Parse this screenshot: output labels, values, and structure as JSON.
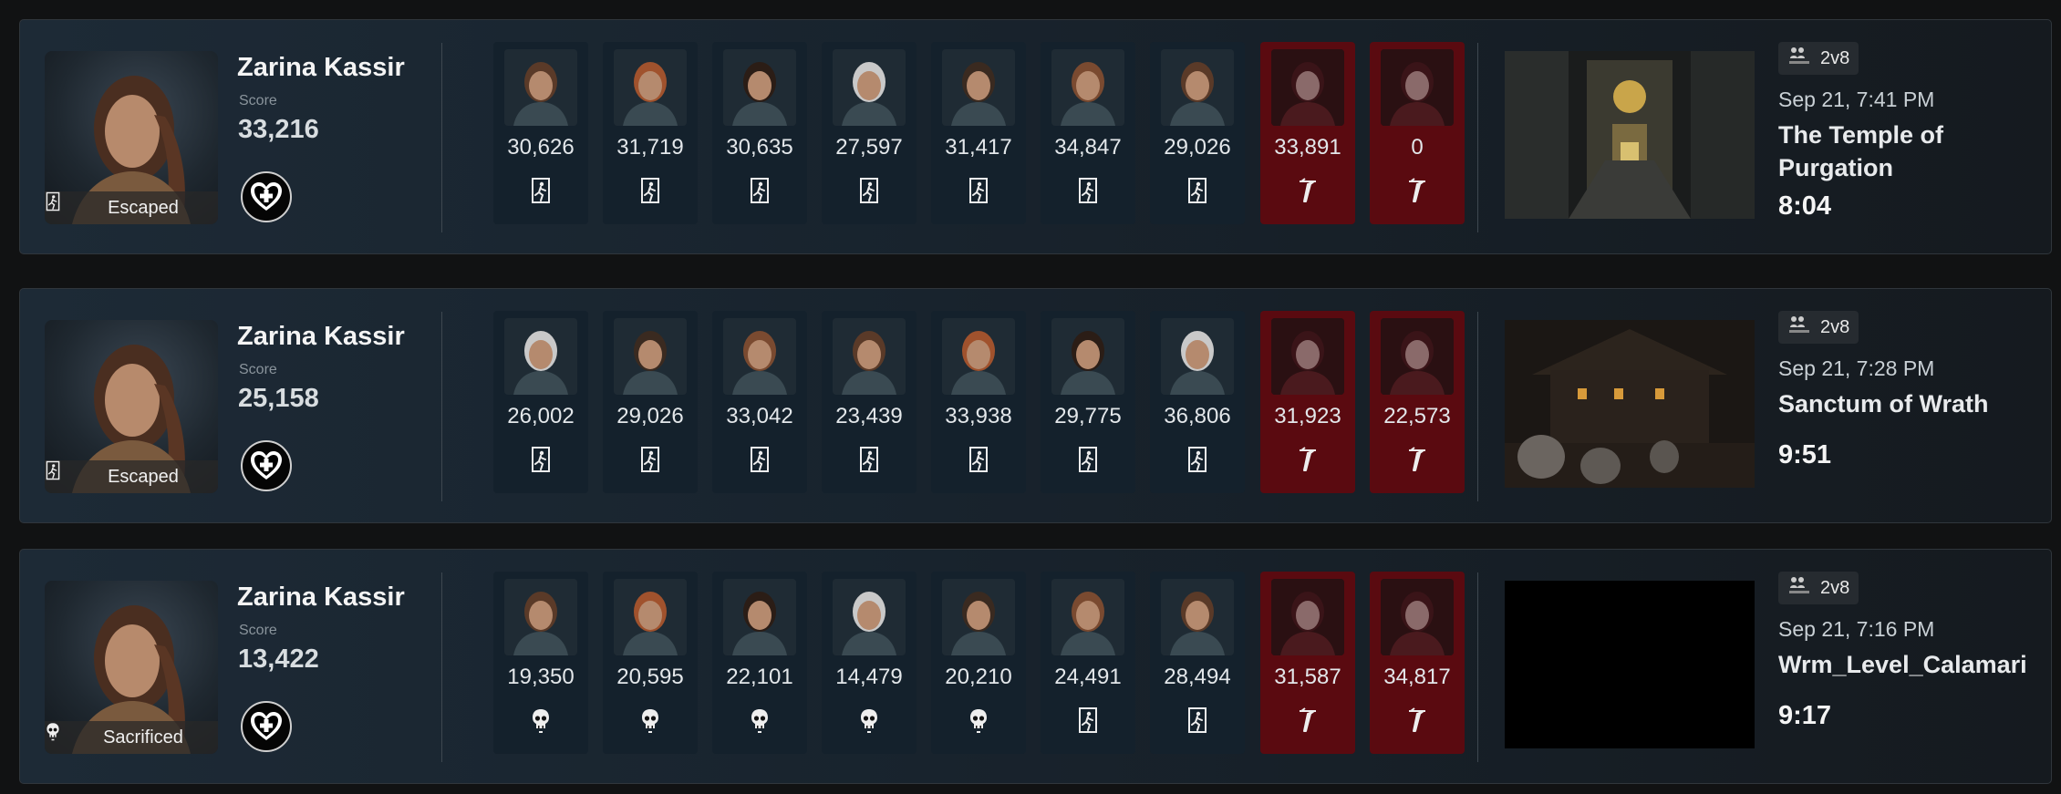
{
  "score_label": "Score",
  "matches": [
    {
      "player_name": "Zarina Kassir",
      "score": "33,216",
      "result": "Escaped",
      "result_icon": "escape-door-icon",
      "mode": "2v8",
      "date": "Sep 21, 7:41 PM",
      "map_name": "The Temple of Purgation",
      "duration": "8:04",
      "map_image": "temple",
      "participants": [
        {
          "score": "30,626",
          "role": "survivor",
          "result": "escaped"
        },
        {
          "score": "31,719",
          "role": "survivor",
          "result": "escaped"
        },
        {
          "score": "30,635",
          "role": "survivor",
          "result": "escaped"
        },
        {
          "score": "27,597",
          "role": "survivor",
          "result": "escaped"
        },
        {
          "score": "31,417",
          "role": "survivor",
          "result": "escaped"
        },
        {
          "score": "34,847",
          "role": "survivor",
          "result": "escaped"
        },
        {
          "score": "29,026",
          "role": "survivor",
          "result": "escaped"
        },
        {
          "score": "33,891",
          "role": "killer",
          "result": "killer"
        },
        {
          "score": "0",
          "role": "killer",
          "result": "killer"
        }
      ]
    },
    {
      "player_name": "Zarina Kassir",
      "score": "25,158",
      "result": "Escaped",
      "result_icon": "escape-door-icon",
      "mode": "2v8",
      "date": "Sep 21, 7:28 PM",
      "map_name": "Sanctum of Wrath",
      "duration": "9:51",
      "map_image": "sanctum",
      "participants": [
        {
          "score": "26,002",
          "role": "survivor",
          "result": "escaped"
        },
        {
          "score": "29,026",
          "role": "survivor",
          "result": "escaped"
        },
        {
          "score": "33,042",
          "role": "survivor",
          "result": "escaped"
        },
        {
          "score": "23,439",
          "role": "survivor",
          "result": "escaped"
        },
        {
          "score": "33,938",
          "role": "survivor",
          "result": "escaped"
        },
        {
          "score": "29,775",
          "role": "survivor",
          "result": "escaped"
        },
        {
          "score": "36,806",
          "role": "survivor",
          "result": "escaped"
        },
        {
          "score": "31,923",
          "role": "killer",
          "result": "killer"
        },
        {
          "score": "22,573",
          "role": "killer",
          "result": "killer"
        }
      ]
    },
    {
      "player_name": "Zarina Kassir",
      "score": "13,422",
      "result": "Sacrificed",
      "result_icon": "skull-icon",
      "mode": "2v8",
      "date": "Sep 21, 7:16 PM",
      "map_name": "Wrm_Level_Calamari",
      "duration": "9:17",
      "map_image": "blank",
      "participants": [
        {
          "score": "19,350",
          "role": "survivor",
          "result": "sacrificed"
        },
        {
          "score": "20,595",
          "role": "survivor",
          "result": "sacrificed"
        },
        {
          "score": "22,101",
          "role": "survivor",
          "result": "sacrificed"
        },
        {
          "score": "14,479",
          "role": "survivor",
          "result": "sacrificed"
        },
        {
          "score": "20,210",
          "role": "survivor",
          "result": "sacrificed"
        },
        {
          "score": "24,491",
          "role": "survivor",
          "result": "escaped"
        },
        {
          "score": "28,494",
          "role": "survivor",
          "result": "escaped"
        },
        {
          "score": "31,587",
          "role": "killer",
          "result": "killer"
        },
        {
          "score": "34,817",
          "role": "killer",
          "result": "killer"
        }
      ]
    }
  ],
  "colors": {
    "card_survivor": "#14212c",
    "card_killer": "#5a0a10",
    "page_bg": "#111213"
  }
}
